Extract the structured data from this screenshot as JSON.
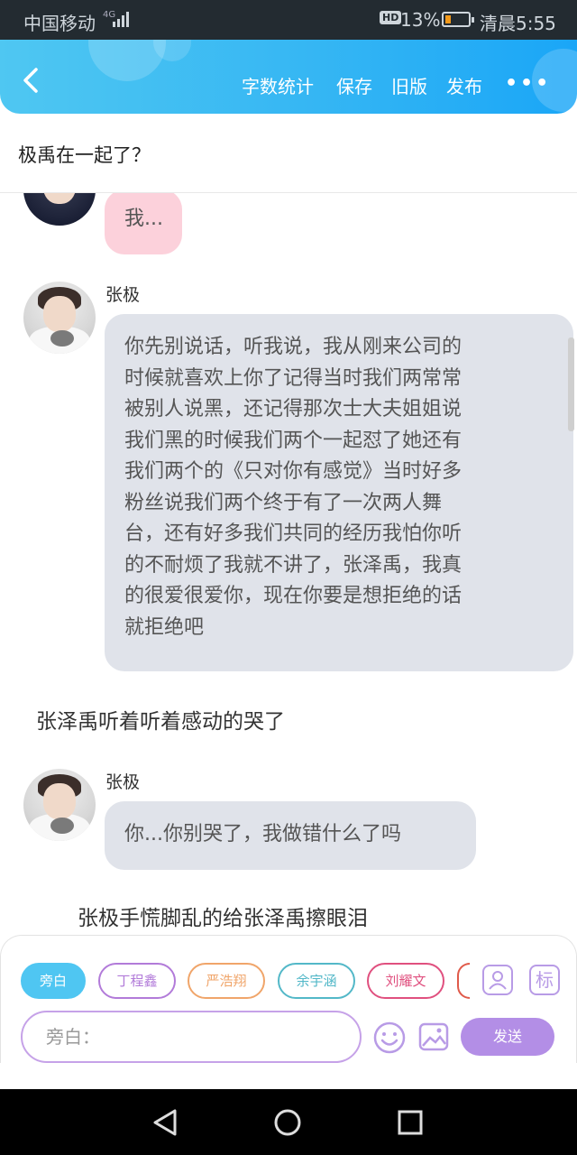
{
  "status_bar": {
    "carrier": "中国移动",
    "network": "4G",
    "hd": "HD",
    "battery_pct": "13%",
    "battery_level": 0.13,
    "time": "清晨5:55"
  },
  "header": {
    "actions": [
      "字数统计",
      "保存",
      "旧版",
      "发布"
    ],
    "more": "•••"
  },
  "doc": {
    "title": "极禹在一起了？"
  },
  "chat": {
    "msg_partial": {
      "text": "我..."
    },
    "msg_long": {
      "name": "张极",
      "lines": [
        "你先别说话，听我说，我从刚来公司的",
        "时候就喜欢上你了记得当时我们两常常",
        "被别人说黑，还记得那次士大夫姐姐说",
        "我们黑的时候我们两个一起怼了她还有",
        "我们两个的《只对你有感觉》当时好多",
        "粉丝说我们两个终于有了一次两人舞",
        "台，还有好多我们共同的经历我怕你听",
        "的不耐烦了我就不讲了，张泽禹，我真",
        "的很爱很爱你，现在你要是想拒绝的话",
        "就拒绝吧"
      ]
    },
    "narration_1": "张泽禹听着听着感动的哭了",
    "msg_short": {
      "name": "张极",
      "text": "你...你别哭了，我做错什么了吗"
    },
    "narration_2": "张极手慌脚乱的给张泽禹擦眼泪"
  },
  "roles": [
    {
      "label": "旁白",
      "color": "#4fc6f2",
      "active": true
    },
    {
      "label": "丁程鑫",
      "color": "#b27bd9",
      "active": false
    },
    {
      "label": "严浩翔",
      "color": "#f0a56a",
      "active": false
    },
    {
      "label": "余宇涵",
      "color": "#53b8c8",
      "active": false
    },
    {
      "label": "刘耀文",
      "color": "#e0507f",
      "active": false
    }
  ],
  "tools": {
    "role_icon": "person-card-icon",
    "tag_label": "标"
  },
  "composer": {
    "placeholder": "旁白：",
    "send_label": "发送"
  },
  "colors": {
    "header_start": "#4fc7f2",
    "header_end": "#1aa6f7",
    "pink_bubble": "#fcd1db",
    "grey_bubble": "#e0e3ea",
    "send": "#b38ee6"
  }
}
